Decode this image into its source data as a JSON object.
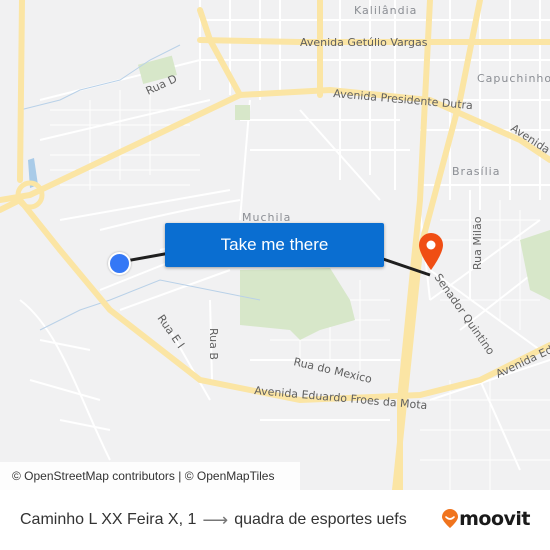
{
  "map": {
    "place_labels": {
      "kalilandia": "Kalilândia",
      "capuchinhos": "Capuchinhos",
      "brasilia": "Brasília",
      "muchila": "Muchila"
    },
    "street_labels": {
      "getulio_vargas": "Avenida Getúlio Vargas",
      "presidente_dutra": "Avenida Presidente Dutra",
      "avenida_right": "Avenida P",
      "rua_d": "Rua D",
      "rua_milao": "Rua Milão",
      "senador_quintino": "Senador Quintino",
      "rua_e1": "Rua E I",
      "rua_b": "Rua B",
      "rua_do_mexico": "Rua do Mexico",
      "eduardo_froes": "Avenida Eduardo Froes da Mota",
      "avenida_ed": "Avenida Ed"
    },
    "cta_label": "Take me there",
    "attribution": "© OpenStreetMap contributors | © OpenMapTiles",
    "colors": {
      "major_road": "#fbe5a4",
      "minor_road": "#ffffff",
      "park": "#d7e7c9",
      "water": "#a9cbe8",
      "route_line": "#1f1f1f",
      "origin": "#3478f6",
      "destination": "#f04e14",
      "cta": "#0a6ed1"
    }
  },
  "footer": {
    "from": "Caminho L XX Feira X, 1",
    "arrow": "⟶",
    "to": "quadra de esportes uefs",
    "brand": "moovit"
  }
}
